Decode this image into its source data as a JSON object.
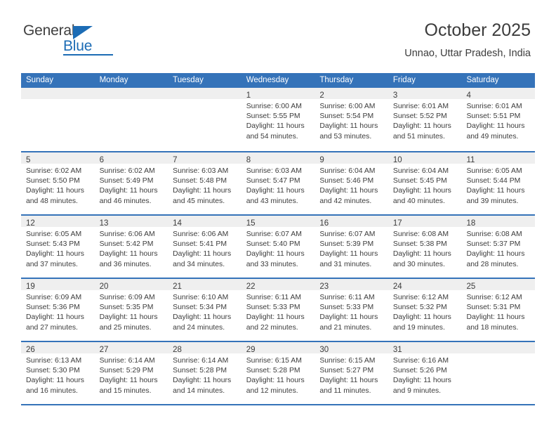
{
  "brand": {
    "name_top": "General",
    "name_bottom": "Blue",
    "accent_color": "#1c6cb5"
  },
  "header": {
    "month_title": "October 2025",
    "location": "Unnao, Uttar Pradesh, India"
  },
  "calendar": {
    "header_bg": "#3573b9",
    "day_header_bg": "#efefef",
    "weekdays": [
      "Sunday",
      "Monday",
      "Tuesday",
      "Wednesday",
      "Thursday",
      "Friday",
      "Saturday"
    ],
    "weeks": [
      [
        {
          "day": "",
          "lines": [
            "",
            "",
            "",
            ""
          ]
        },
        {
          "day": "",
          "lines": [
            "",
            "",
            "",
            ""
          ]
        },
        {
          "day": "",
          "lines": [
            "",
            "",
            "",
            ""
          ]
        },
        {
          "day": "1",
          "lines": [
            "Sunrise: 6:00 AM",
            "Sunset: 5:55 PM",
            "Daylight: 11 hours",
            "and 54 minutes."
          ]
        },
        {
          "day": "2",
          "lines": [
            "Sunrise: 6:00 AM",
            "Sunset: 5:54 PM",
            "Daylight: 11 hours",
            "and 53 minutes."
          ]
        },
        {
          "day": "3",
          "lines": [
            "Sunrise: 6:01 AM",
            "Sunset: 5:52 PM",
            "Daylight: 11 hours",
            "and 51 minutes."
          ]
        },
        {
          "day": "4",
          "lines": [
            "Sunrise: 6:01 AM",
            "Sunset: 5:51 PM",
            "Daylight: 11 hours",
            "and 49 minutes."
          ]
        }
      ],
      [
        {
          "day": "5",
          "lines": [
            "Sunrise: 6:02 AM",
            "Sunset: 5:50 PM",
            "Daylight: 11 hours",
            "and 48 minutes."
          ]
        },
        {
          "day": "6",
          "lines": [
            "Sunrise: 6:02 AM",
            "Sunset: 5:49 PM",
            "Daylight: 11 hours",
            "and 46 minutes."
          ]
        },
        {
          "day": "7",
          "lines": [
            "Sunrise: 6:03 AM",
            "Sunset: 5:48 PM",
            "Daylight: 11 hours",
            "and 45 minutes."
          ]
        },
        {
          "day": "8",
          "lines": [
            "Sunrise: 6:03 AM",
            "Sunset: 5:47 PM",
            "Daylight: 11 hours",
            "and 43 minutes."
          ]
        },
        {
          "day": "9",
          "lines": [
            "Sunrise: 6:04 AM",
            "Sunset: 5:46 PM",
            "Daylight: 11 hours",
            "and 42 minutes."
          ]
        },
        {
          "day": "10",
          "lines": [
            "Sunrise: 6:04 AM",
            "Sunset: 5:45 PM",
            "Daylight: 11 hours",
            "and 40 minutes."
          ]
        },
        {
          "day": "11",
          "lines": [
            "Sunrise: 6:05 AM",
            "Sunset: 5:44 PM",
            "Daylight: 11 hours",
            "and 39 minutes."
          ]
        }
      ],
      [
        {
          "day": "12",
          "lines": [
            "Sunrise: 6:05 AM",
            "Sunset: 5:43 PM",
            "Daylight: 11 hours",
            "and 37 minutes."
          ]
        },
        {
          "day": "13",
          "lines": [
            "Sunrise: 6:06 AM",
            "Sunset: 5:42 PM",
            "Daylight: 11 hours",
            "and 36 minutes."
          ]
        },
        {
          "day": "14",
          "lines": [
            "Sunrise: 6:06 AM",
            "Sunset: 5:41 PM",
            "Daylight: 11 hours",
            "and 34 minutes."
          ]
        },
        {
          "day": "15",
          "lines": [
            "Sunrise: 6:07 AM",
            "Sunset: 5:40 PM",
            "Daylight: 11 hours",
            "and 33 minutes."
          ]
        },
        {
          "day": "16",
          "lines": [
            "Sunrise: 6:07 AM",
            "Sunset: 5:39 PM",
            "Daylight: 11 hours",
            "and 31 minutes."
          ]
        },
        {
          "day": "17",
          "lines": [
            "Sunrise: 6:08 AM",
            "Sunset: 5:38 PM",
            "Daylight: 11 hours",
            "and 30 minutes."
          ]
        },
        {
          "day": "18",
          "lines": [
            "Sunrise: 6:08 AM",
            "Sunset: 5:37 PM",
            "Daylight: 11 hours",
            "and 28 minutes."
          ]
        }
      ],
      [
        {
          "day": "19",
          "lines": [
            "Sunrise: 6:09 AM",
            "Sunset: 5:36 PM",
            "Daylight: 11 hours",
            "and 27 minutes."
          ]
        },
        {
          "day": "20",
          "lines": [
            "Sunrise: 6:09 AM",
            "Sunset: 5:35 PM",
            "Daylight: 11 hours",
            "and 25 minutes."
          ]
        },
        {
          "day": "21",
          "lines": [
            "Sunrise: 6:10 AM",
            "Sunset: 5:34 PM",
            "Daylight: 11 hours",
            "and 24 minutes."
          ]
        },
        {
          "day": "22",
          "lines": [
            "Sunrise: 6:11 AM",
            "Sunset: 5:33 PM",
            "Daylight: 11 hours",
            "and 22 minutes."
          ]
        },
        {
          "day": "23",
          "lines": [
            "Sunrise: 6:11 AM",
            "Sunset: 5:33 PM",
            "Daylight: 11 hours",
            "and 21 minutes."
          ]
        },
        {
          "day": "24",
          "lines": [
            "Sunrise: 6:12 AM",
            "Sunset: 5:32 PM",
            "Daylight: 11 hours",
            "and 19 minutes."
          ]
        },
        {
          "day": "25",
          "lines": [
            "Sunrise: 6:12 AM",
            "Sunset: 5:31 PM",
            "Daylight: 11 hours",
            "and 18 minutes."
          ]
        }
      ],
      [
        {
          "day": "26",
          "lines": [
            "Sunrise: 6:13 AM",
            "Sunset: 5:30 PM",
            "Daylight: 11 hours",
            "and 16 minutes."
          ]
        },
        {
          "day": "27",
          "lines": [
            "Sunrise: 6:14 AM",
            "Sunset: 5:29 PM",
            "Daylight: 11 hours",
            "and 15 minutes."
          ]
        },
        {
          "day": "28",
          "lines": [
            "Sunrise: 6:14 AM",
            "Sunset: 5:28 PM",
            "Daylight: 11 hours",
            "and 14 minutes."
          ]
        },
        {
          "day": "29",
          "lines": [
            "Sunrise: 6:15 AM",
            "Sunset: 5:28 PM",
            "Daylight: 11 hours",
            "and 12 minutes."
          ]
        },
        {
          "day": "30",
          "lines": [
            "Sunrise: 6:15 AM",
            "Sunset: 5:27 PM",
            "Daylight: 11 hours",
            "and 11 minutes."
          ]
        },
        {
          "day": "31",
          "lines": [
            "Sunrise: 6:16 AM",
            "Sunset: 5:26 PM",
            "Daylight: 11 hours",
            "and 9 minutes."
          ]
        },
        {
          "day": "",
          "lines": [
            "",
            "",
            "",
            ""
          ]
        }
      ]
    ]
  }
}
